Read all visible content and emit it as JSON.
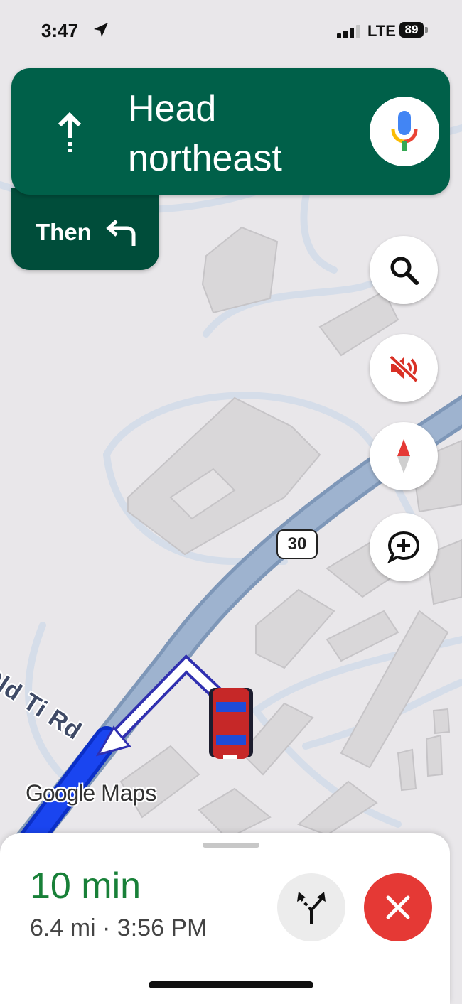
{
  "status_bar": {
    "time": "3:47",
    "network": "LTE",
    "battery": "89"
  },
  "direction": {
    "instruction": "Head northeast",
    "then_label": "Then"
  },
  "map": {
    "route_shield": "30",
    "road_name": "Old Ti Rd",
    "watermark_google": "Google",
    "watermark_maps": "Maps"
  },
  "trip": {
    "eta_duration": "10 min",
    "distance_arrival": "6.4 mi · 3:56 PM"
  },
  "colors": {
    "nav_green": "#006049",
    "then_green": "#004d3a",
    "eta_green": "#188038",
    "exit_red": "#e53935",
    "route_blue": "#1a45f0"
  },
  "icons": {
    "direction": "straight-arrow-icon",
    "then": "turn-left-icon",
    "mic": "mic-icon",
    "search": "search-icon",
    "mute": "sound-off-icon",
    "compass": "compass-icon",
    "report": "add-report-icon",
    "alternates": "alternate-routes-icon",
    "close": "close-icon",
    "location": "location-arrow-icon",
    "signal": "signal-bars-icon"
  }
}
